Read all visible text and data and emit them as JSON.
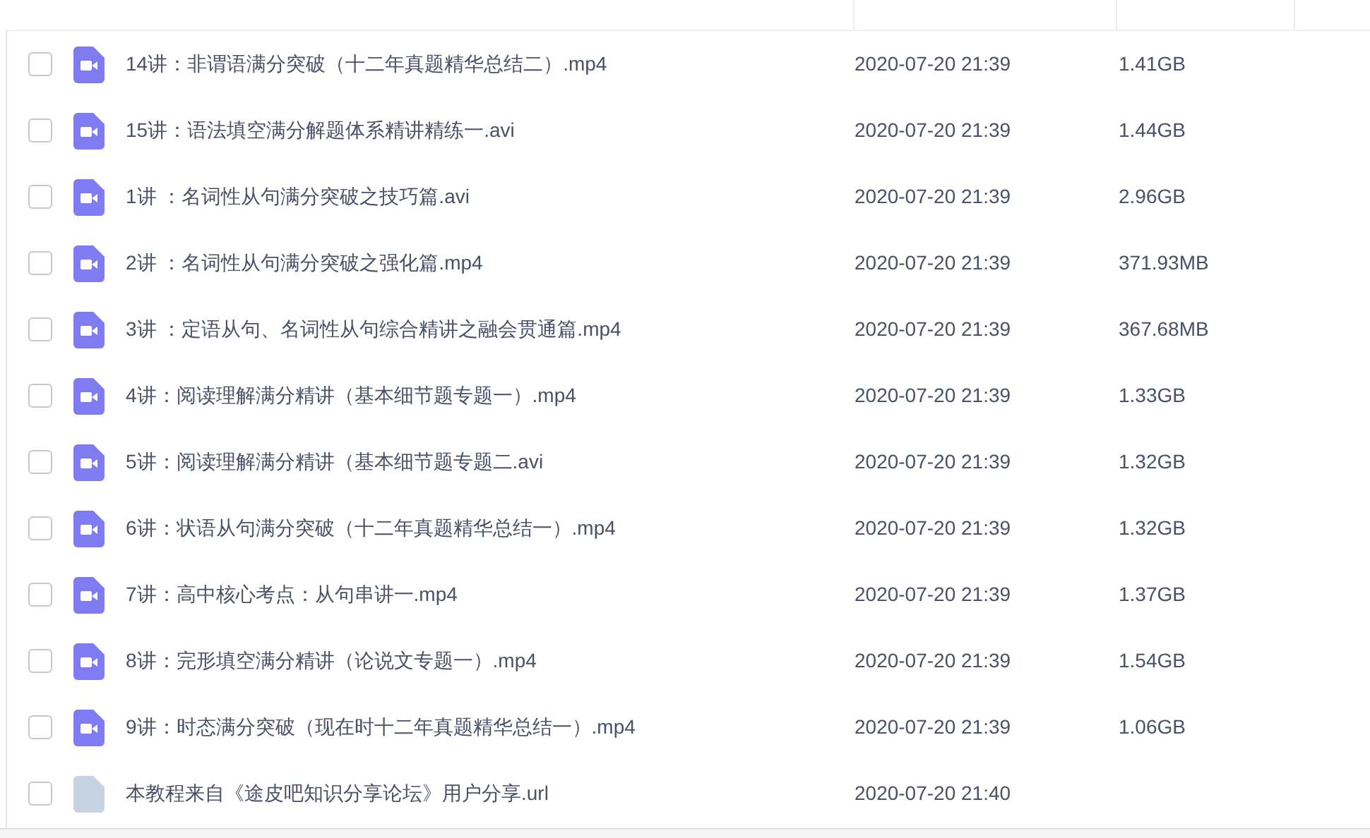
{
  "files": [
    {
      "kind": "video",
      "name": "14讲：非谓语满分突破（十二年真题精华总结二）.mp4",
      "modified": "2020-07-20 21:39",
      "size": "1.41GB",
      "checked": false
    },
    {
      "kind": "video",
      "name": "15讲：语法填空满分解题体系精讲精练一.avi",
      "modified": "2020-07-20 21:39",
      "size": "1.44GB",
      "checked": false
    },
    {
      "kind": "video",
      "name": "1讲 ：名词性从句满分突破之技巧篇.avi",
      "modified": "2020-07-20 21:39",
      "size": "2.96GB",
      "checked": false
    },
    {
      "kind": "video",
      "name": "2讲 ：名词性从句满分突破之强化篇.mp4",
      "modified": "2020-07-20 21:39",
      "size": "371.93MB",
      "checked": false
    },
    {
      "kind": "video",
      "name": "3讲 ：定语从句、名词性从句综合精讲之融会贯通篇.mp4",
      "modified": "2020-07-20 21:39",
      "size": "367.68MB",
      "checked": false
    },
    {
      "kind": "video",
      "name": "4讲：阅读理解满分精讲（基本细节题专题一）.mp4",
      "modified": "2020-07-20 21:39",
      "size": "1.33GB",
      "checked": false
    },
    {
      "kind": "video",
      "name": "5讲：阅读理解满分精讲（基本细节题专题二.avi",
      "modified": "2020-07-20 21:39",
      "size": "1.32GB",
      "checked": false
    },
    {
      "kind": "video",
      "name": "6讲：状语从句满分突破（十二年真题精华总结一）.mp4",
      "modified": "2020-07-20 21:39",
      "size": "1.32GB",
      "checked": false
    },
    {
      "kind": "video",
      "name": "7讲：高中核心考点：从句串讲一.mp4",
      "modified": "2020-07-20 21:39",
      "size": "1.37GB",
      "checked": false
    },
    {
      "kind": "video",
      "name": "8讲：完形填空满分精讲（论说文专题一）.mp4",
      "modified": "2020-07-20 21:39",
      "size": "1.54GB",
      "checked": false
    },
    {
      "kind": "video",
      "name": "9讲：时态满分突破（现在时十二年真题精华总结一）.mp4",
      "modified": "2020-07-20 21:39",
      "size": "1.06GB",
      "checked": false
    },
    {
      "kind": "link",
      "name": "本教程来自《途皮吧知识分享论坛》用户分享.url",
      "modified": "2020-07-20 21:40",
      "checked": false
    }
  ]
}
